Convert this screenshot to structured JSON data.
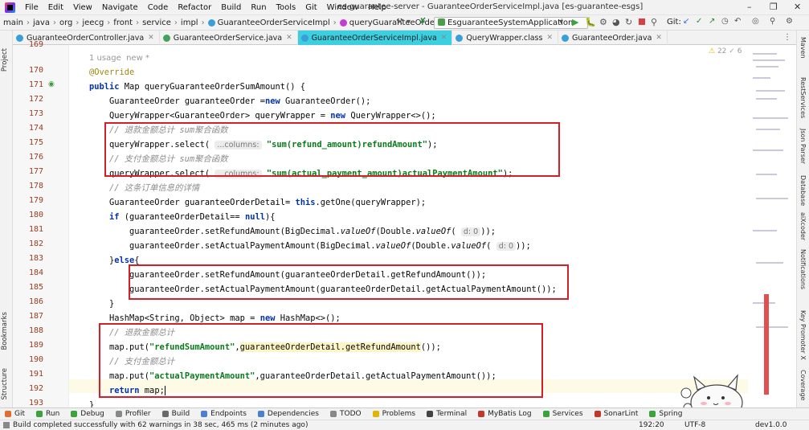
{
  "title_bar": {
    "menu": [
      "File",
      "Edit",
      "View",
      "Navigate",
      "Code",
      "Refactor",
      "Build",
      "Run",
      "Tools",
      "Git",
      "Window",
      "Help"
    ],
    "window_title": "es-guarantee-server - GuaranteeOrderServiceImpl.java [es-guarantee-esgs]"
  },
  "nav_bar": {
    "breadcrumbs": [
      "main",
      "java",
      "org",
      "jeecg",
      "front",
      "service",
      "impl",
      "GuaranteeOrderServiceImpl",
      "queryGuaranteeOrderSumAmount"
    ],
    "run_config": "EsguaranteeSystemApplication",
    "git_label": "Git:"
  },
  "tabs": [
    {
      "label": "GuaranteeOrderController.java",
      "active": false
    },
    {
      "label": "GuaranteeOrderService.java",
      "active": false
    },
    {
      "label": "GuaranteeOrderServiceImpl.java",
      "active": true
    },
    {
      "label": "QueryWrapper.class",
      "active": false
    },
    {
      "label": "GuaranteeOrder.java",
      "active": false
    }
  ],
  "left_tools": [
    "Project",
    "Bookmarks",
    "Structure"
  ],
  "right_tools": [
    "Maven",
    "RestServices",
    "Json Parser",
    "Database",
    "aiXcoder",
    "Notifications",
    "Key Promoter X",
    "Coverage"
  ],
  "editor": {
    "inspection": {
      "warnings": "22",
      "weak": "6"
    },
    "usage_hint": {
      "usages": "1 usage",
      "author": "new *"
    },
    "line_numbers": [
      "169",
      "170",
      "171",
      "172",
      "173",
      "174",
      "175",
      "176",
      "177",
      "178",
      "179",
      "180",
      "181",
      "182",
      "183",
      "184",
      "185",
      "186",
      "187",
      "188",
      "189",
      "190",
      "191",
      "192",
      "193"
    ],
    "code": {
      "l170": "@Override",
      "l171_kw": "public",
      "l171_rest": " Map queryGuaranteeOrderSumAmount() {",
      "l172_type": "GuaranteeOrder ",
      "l172_var": "guaranteeOrder",
      "l172_eq": " =",
      "l172_new": "new",
      "l172_rest": " GuaranteeOrder();",
      "l173_type": "QueryWrapper<GuaranteeOrder> ",
      "l173_var": "queryWrapper",
      "l173_eq": " = ",
      "l173_new": "new",
      "l173_rest": " QueryWrapper<>();",
      "l174_comment": "// 退款金额总计 sum聚合函数",
      "l175_pre": "queryWrapper.select( ",
      "l175_hint": "...columns:",
      "l175_str": "\"sum(refund_amount)refundAmount\"",
      "l175_post": ");",
      "l176_comment": "// 支付金额总计 sum聚合函数",
      "l177_pre": "queryWrapper.select( ",
      "l177_hint": "...columns:",
      "l177_str": "\"sum(actual_payment_amount)actualPaymentAmount\"",
      "l177_post": ");",
      "l178_comment": "// 这条订单信息的详情",
      "l179_type": "GuaranteeOrder ",
      "l179_var": "guaranteeOrderDetail",
      "l179_eq": "= ",
      "l179_this": "this",
      "l179_rest": ".getOne(queryWrapper);",
      "l180_if": "if",
      "l180_open": " (",
      "l180_var": "guaranteeOrderDetail",
      "l180_op": "== ",
      "l180_null": "null",
      "l180_close": "){",
      "l181_pre": "guaranteeOrder.setRefundAmount(BigDecimal.",
      "l181_valueof": "valueOf",
      "l181_mid": "(Double.",
      "l181_valueof2": "valueOf",
      "l181_open2": "( ",
      "l181_hint": "d: 0",
      "l181_close": "));",
      "l182_pre": "guaranteeOrder.setActualPaymentAmount(BigDecimal.",
      "l182_valueof": "valueOf",
      "l182_mid": "(Double.",
      "l182_valueof2": "valueOf",
      "l182_open2": "( ",
      "l182_hint": "d: 0",
      "l182_close": "));",
      "l183_close": "}",
      "l183_else": "else",
      "l183_open": "{",
      "l184": "guaranteeOrder.setRefundAmount(guaranteeOrderDetail.getRefundAmount());",
      "l185": "guaranteeOrder.setActualPaymentAmount(guaranteeOrderDetail.getActualPaymentAmount());",
      "l186": "}",
      "l187_pre": "HashMap<String, Object> ",
      "l187_var": "map",
      "l187_eq": " = ",
      "l187_new": "new",
      "l187_rest": " HashMap<>();",
      "l188_comment": "// 退款金额总计",
      "l189_pre": "map.put(",
      "l189_str": "\"refundSumAmount\"",
      "l189_sep": ",",
      "l189_hl": "guaranteeOrderDetail.getRefundAmount",
      "l189_post": "());",
      "l190_comment": "// 支付金额总计",
      "l191_pre": "map.put(",
      "l191_str": "\"actualPaymentAmount\"",
      "l191_rest": ",guaranteeOrderDetail.getActualPaymentAmount());",
      "l192_kw": "return",
      "l192_rest": " map;",
      "l193": "}"
    }
  },
  "tool_windows": [
    "Git",
    "Run",
    "Debug",
    "Profiler",
    "Build",
    "Endpoints",
    "Dependencies",
    "TODO",
    "Problems",
    "Terminal",
    "MyBatis Log",
    "Services",
    "SonarLint",
    "Spring"
  ],
  "status_bar": {
    "message": "Build completed successfully with 62 warnings in 38 sec, 465 ms (2 minutes ago)",
    "position": "192:20",
    "encoding": "UTF-8",
    "branch": "dev1.0.0"
  },
  "colors": {
    "highlight_box": "#d32028",
    "active_tab": "#3bcfe0",
    "keyword": "#0033b3",
    "string": "#067d17",
    "comment": "#8c8c8c"
  }
}
